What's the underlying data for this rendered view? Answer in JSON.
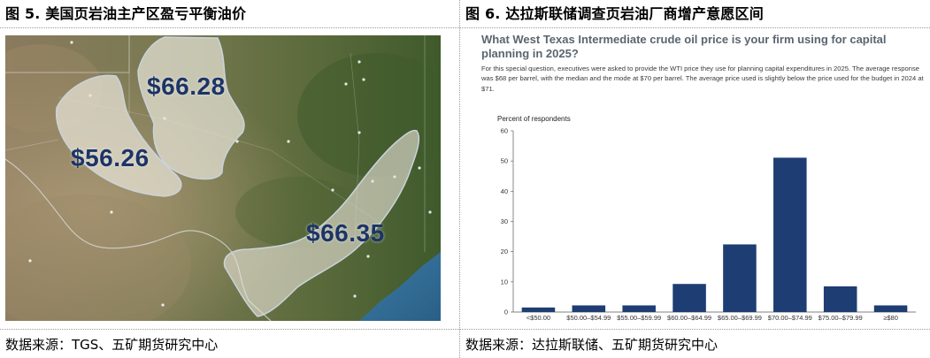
{
  "left": {
    "title": "图 5. 美国页岩油主产区盈亏平衡油价",
    "prices": [
      "$66.28",
      "$56.26",
      "$66.35"
    ],
    "source": "数据来源：TGS、五矿期货研究中心"
  },
  "right": {
    "title": "图 6.  达拉斯联储调查页岩油厂商增产意愿区间",
    "chart_title": "What West Texas Intermediate crude oil price is your firm using for capital planning in 2025?",
    "note": "For this special question, executives were asked to provide the WTI price they use for planning capital expenditures in 2025. The average response was $68 per barrel, with the median and the mode at $70 per barrel. The average price used is slightly below the price used for the budget in 2024 at $71.",
    "source": "数据来源：达拉斯联储、五矿期货研究中心"
  },
  "chart_data": {
    "type": "bar",
    "title": "What West Texas Intermediate crude oil price is your firm using for capital planning in 2025?",
    "ylabel": "Percent of respondents",
    "xlabel": "",
    "categories": [
      "<$50.00",
      "$50.00–$54.99",
      "$55.00–$59.99",
      "$60.00–$64.99",
      "$65.00–$69.99",
      "$70.00–$74.99",
      "$75.00–$79.99",
      "≥$80"
    ],
    "values": [
      1.5,
      2.2,
      2.2,
      9.3,
      22.4,
      51.1,
      8.5,
      2.2
    ],
    "ylim": [
      0,
      60
    ],
    "yticks": [
      0,
      10,
      20,
      30,
      40,
      50,
      60
    ],
    "bar_color": "#1d3d73",
    "grid": false,
    "legend": "none"
  }
}
